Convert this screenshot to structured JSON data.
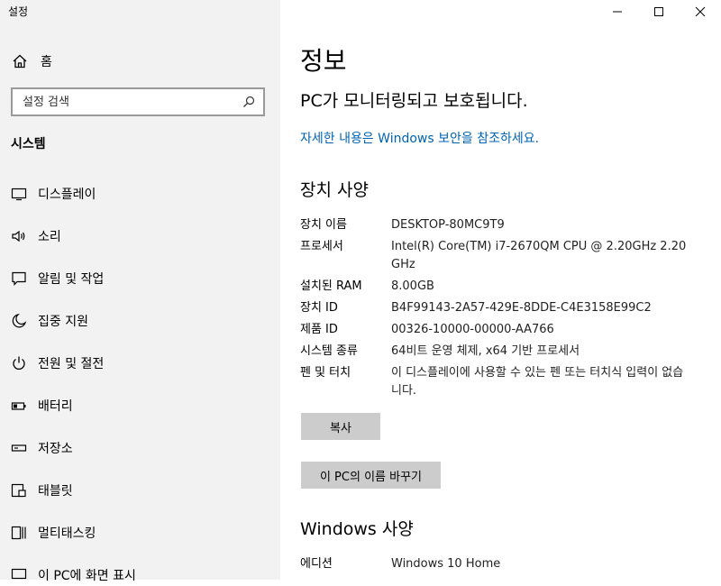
{
  "window": {
    "title": "설정",
    "minimize_label": "최소화",
    "maximize_label": "최대화",
    "close_label": "닫기"
  },
  "sidebar": {
    "home_label": "홈",
    "search_placeholder": "설정 검색",
    "section_title": "시스템",
    "items": [
      {
        "label": "디스플레이",
        "icon": "monitor-icon"
      },
      {
        "label": "소리",
        "icon": "speaker-icon"
      },
      {
        "label": "알림 및 작업",
        "icon": "notification-icon"
      },
      {
        "label": "집중 지원",
        "icon": "moon-icon"
      },
      {
        "label": "전원 및 절전",
        "icon": "power-icon"
      },
      {
        "label": "배터리",
        "icon": "battery-icon"
      },
      {
        "label": "저장소",
        "icon": "storage-icon"
      },
      {
        "label": "태블릿",
        "icon": "tablet-icon"
      },
      {
        "label": "멀티태스킹",
        "icon": "multitasking-icon"
      },
      {
        "label": "이 PC에 화면 표시",
        "icon": "projecting-icon"
      }
    ]
  },
  "main": {
    "title": "정보",
    "protection_status": "PC가 모니터링되고 보호됩니다.",
    "security_link": "자세한 내용은 Windows 보안을 참조하세요.",
    "device_specs_heading": "장치 사양",
    "device_specs": [
      {
        "label": "장치 이름",
        "value": "DESKTOP-80MC9T9"
      },
      {
        "label": "프로세서",
        "value": "Intel(R) Core(TM) i7-2670QM CPU @ 2.20GHz   2.20 GHz"
      },
      {
        "label": "설치된 RAM",
        "value": "8.00GB"
      },
      {
        "label": "장치 ID",
        "value": "B4F99143-2A57-429E-8DDE-C4E3158E99C2"
      },
      {
        "label": "제품 ID",
        "value": "00326-10000-00000-AA766"
      },
      {
        "label": "시스템 종류",
        "value": "64비트 운영 체제, x64 기반 프로세서"
      },
      {
        "label": "펜 및 터치",
        "value": "이 디스플레이에 사용할 수 있는 펜 또는 터치식 입력이 없습니다."
      }
    ],
    "copy_button": "복사",
    "rename_button": "이 PC의 이름 바꾸기",
    "windows_specs_heading": "Windows 사양",
    "windows_specs": [
      {
        "label": "에디션",
        "value": "Windows 10 Home"
      }
    ]
  },
  "colors": {
    "sidebar_bg": "#f2f2f2",
    "link": "#0063b1",
    "button_bg": "#cccccc"
  }
}
